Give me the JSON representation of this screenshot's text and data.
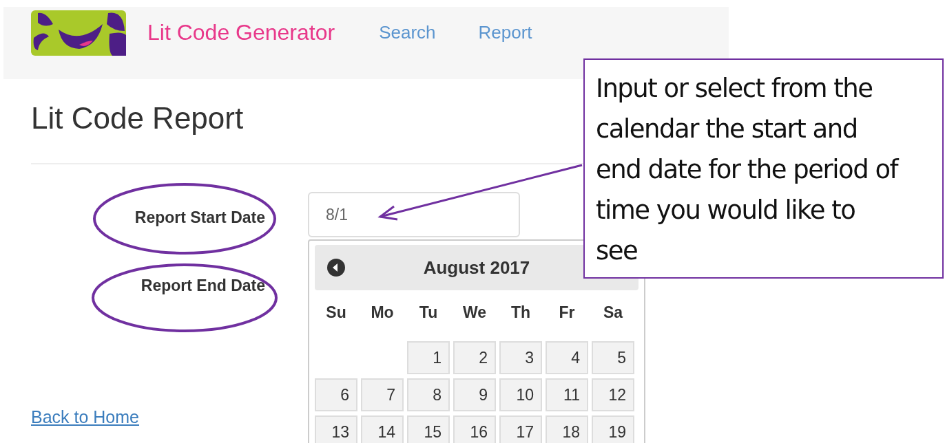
{
  "navbar": {
    "brand": "Lit Code Generator",
    "links": [
      {
        "label": "Search"
      },
      {
        "label": "Report"
      }
    ]
  },
  "page_title": "Lit Code Report",
  "form": {
    "start_label": "Report Start Date",
    "start_value": "8/1",
    "end_label": "Report End Date"
  },
  "calendar": {
    "month": "August 2017",
    "weekdays": [
      "Su",
      "Mo",
      "Tu",
      "We",
      "Th",
      "Fr",
      "Sa"
    ],
    "weeks": [
      [
        "1",
        "2",
        "3",
        "4",
        "5"
      ],
      [
        "6",
        "7",
        "8",
        "9",
        "10",
        "11",
        "12"
      ],
      [
        "13",
        "14",
        "15",
        "16",
        "17",
        "18",
        "19"
      ]
    ]
  },
  "back_link": "Back to Home",
  "callout": "Input or select from the calendar the start and end date for the period of time you would like to see"
}
